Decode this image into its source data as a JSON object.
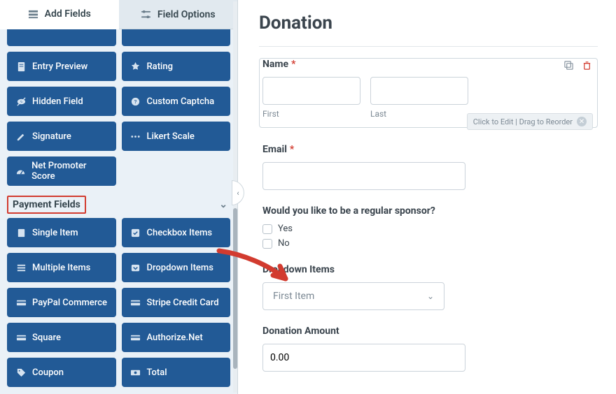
{
  "tabs": {
    "add_fields": "Add Fields",
    "field_options": "Field Options"
  },
  "groups": {
    "standard_btns": [
      "Entry Preview",
      "Rating",
      "Hidden Field",
      "Custom Captcha",
      "Signature",
      "Likert Scale",
      "Net Promoter Score"
    ],
    "payment_title": "Payment Fields",
    "payment_btns": [
      "Single Item",
      "Checkbox Items",
      "Multiple Items",
      "Dropdown Items",
      "PayPal Commerce",
      "Stripe Credit Card",
      "Square",
      "Authorize.Net",
      "Coupon",
      "Total"
    ]
  },
  "form": {
    "title": "Donation",
    "name_label": "Name",
    "name_first_sub": "First",
    "name_last_sub": "Last",
    "email_label": "Email",
    "sponsor_q": "Would you like to be a regular sponsor?",
    "opt_yes": "Yes",
    "opt_no": "No",
    "dropdown_label": "Dropdown Items",
    "dropdown_value": "First Item",
    "donation_label": "Donation Amount",
    "donation_value": "0.00",
    "hint": "Click to Edit | Drag to Reorder",
    "required": "*"
  }
}
